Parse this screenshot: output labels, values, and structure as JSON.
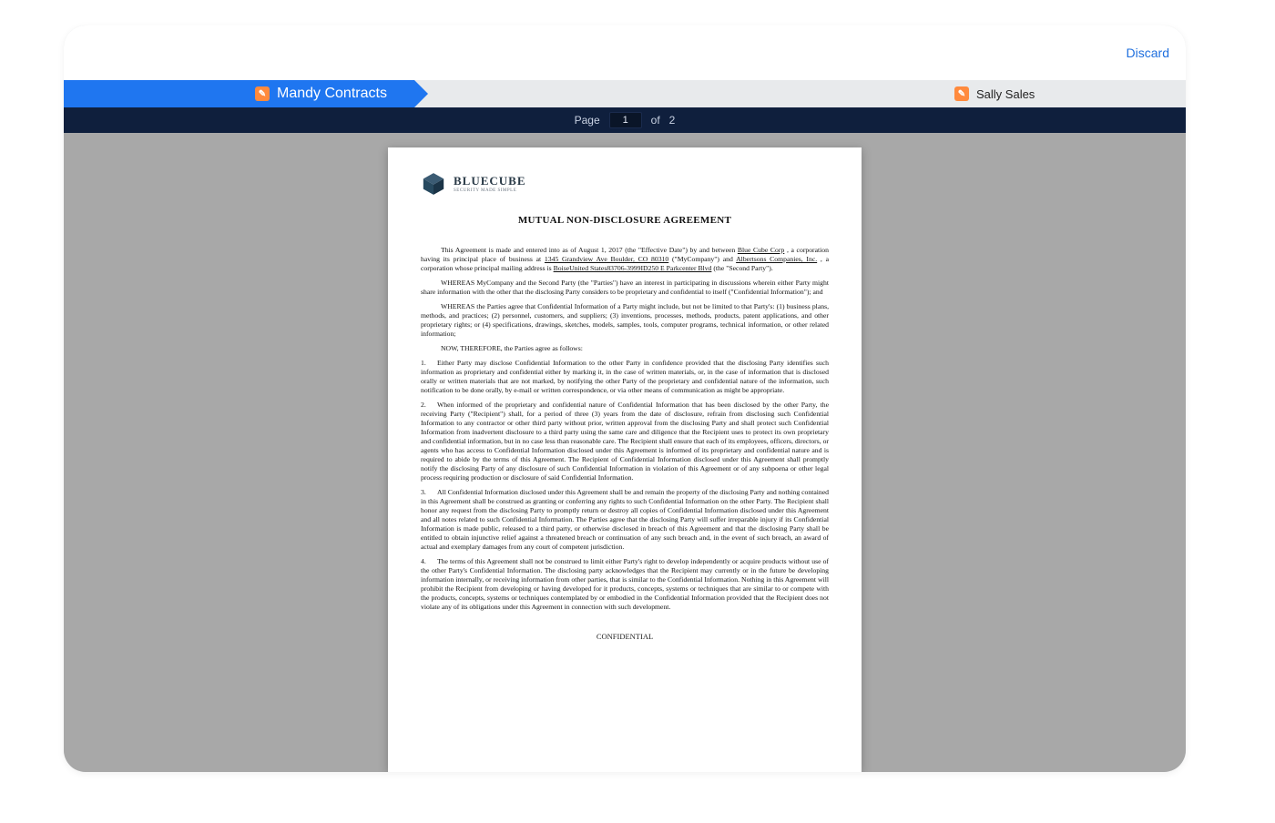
{
  "top": {
    "discard": "Discard"
  },
  "signers": {
    "active": {
      "badge": "✎",
      "name": "Mandy Contracts"
    },
    "inactive": {
      "badge": "✎",
      "name": "Sally Sales"
    }
  },
  "pagebar": {
    "label": "Page",
    "current": "1",
    "of": "of",
    "total": "2"
  },
  "doc": {
    "logo": {
      "brand": "BLUECUBE",
      "tagline": "SECURITY MADE SIMPLE"
    },
    "title": "MUTUAL NON-DISCLOSURE AGREEMENT",
    "intro": {
      "pre1": "This Agreement is made and entered into as of August 1, 2017 (the \"Effective Date\") by and between ",
      "company1": "Blue Cube Corp",
      "mid1": " , a corporation having its principal place of business at ",
      "addr": "1345 Grandview Ave  Boulder, CO 80310",
      "mid2": " (\"MyCompany\") and ",
      "company2": "Albertsons Companies, Inc.",
      "mid3": " , a corporation whose principal mailing address is ",
      "addr2": "BoiseUnited States83706-3999ID250 E Parkcenter Blvd",
      "tail": "  (the \"Second Party\")."
    },
    "whereas1": "WHEREAS MyCompany and the Second Party (the \"Parties\") have an interest in participating in discussions wherein either Party might share information with the other that the disclosing Party considers to be proprietary and confidential to itself (\"Confidential Information\"); and",
    "whereas2": "WHEREAS the Parties agree that Confidential Information of a Party might include, but not be limited to that Party's: (1) business plans, methods, and practices; (2) personnel, customers, and suppliers; (3) inventions, processes, methods, products, patent applications, and other proprietary rights; or (4) specifications, drawings, sketches, models, samples, tools, computer programs, technical information, or other related information;",
    "therefore": "NOW, THEREFORE, the Parties agree as follows:",
    "items": [
      "Either Party may disclose Confidential Information to the other Party in confidence provided that the disclosing Party identifies such information as proprietary and confidential either by marking it, in the case of written materials, or, in the case of information that is disclosed orally or written materials that are not marked, by notifying the other Party of the proprietary and confidential nature of the information, such notification to be done orally, by e-mail or written correspondence, or via other means of communication as might be appropriate.",
      "When informed of the proprietary and confidential nature of Confidential Information that has been disclosed by the other Party, the receiving Party (\"Recipient\") shall, for a period of three (3) years from the date of disclosure, refrain from disclosing such Confidential Information to any contractor or other third party without prior, written approval from the disclosing Party and shall protect such Confidential Information from inadvertent disclosure to a third party using the same care and diligence that the Recipient uses to protect its own proprietary and confidential information, but in no case less than reasonable care. The Recipient shall ensure that each of its employees, officers, directors, or agents who has access to Confidential Information disclosed under this Agreement is informed of its proprietary and confidential nature and is required to abide by the terms of this Agreement.  The Recipient of Confidential Information disclosed under this Agreement shall promptly notify the disclosing Party of any disclosure of such Confidential Information in violation of this Agreement or of any subpoena or other legal process requiring production or disclosure of said Confidential Information.",
      "All Confidential Information disclosed under this Agreement shall be and remain the property of the disclosing Party and nothing contained in this Agreement shall be construed as granting or conferring any rights to such Confidential Information on the other Party.  The Recipient shall honor any request from the disclosing Party to promptly return or destroy all copies of Confidential Information disclosed under this Agreement and all notes related to such Confidential Information. The Parties agree that the disclosing Party will suffer irreparable injury if its Confidential Information is made public, released to a third party, or otherwise disclosed in breach of this Agreement and that the disclosing Party shall be entitled to obtain injunctive relief against a threatened breach or continuation of any such breach and, in the event of such breach, an award of actual and exemplary damages from any court of competent jurisdiction.",
      "The terms of this Agreement shall not be construed to limit either Party's right to develop independently or acquire products without use of the other Party's Confidential Information. The disclosing party acknowledges that the Recipient may currently or in the future be developing information internally, or receiving information from other parties, that is similar to the Confidential Information. Nothing in this Agreement will prohibit the Recipient from developing or having developed for it products, concepts, systems or techniques that are similar to or compete with the products, concepts, systems or techniques contemplated by or embodied in the Confidential Information provided that the Recipient does not violate any of its obligations under this Agreement in connection with such development."
    ],
    "footer": "CONFIDENTIAL"
  }
}
